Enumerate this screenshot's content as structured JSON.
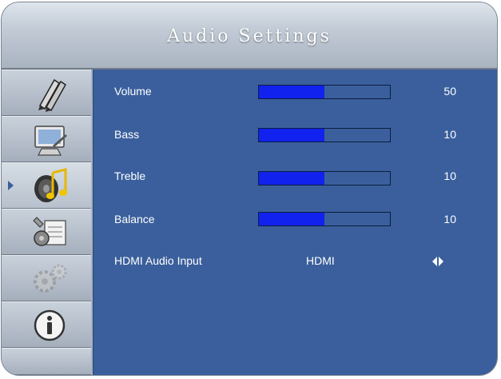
{
  "title": "Audio Settings",
  "sidebar": {
    "items": [
      {
        "icon": "pencils-icon"
      },
      {
        "icon": "monitor-icon"
      },
      {
        "icon": "music-note-icon",
        "active": true
      },
      {
        "icon": "tools-icon"
      },
      {
        "icon": "gears-icon"
      },
      {
        "icon": "info-icon"
      }
    ]
  },
  "settings": {
    "volume": {
      "label": "Volume",
      "value": "50",
      "level": 0.5
    },
    "bass": {
      "label": "Bass",
      "value": "10",
      "level": 0.5
    },
    "treble": {
      "label": "Treble",
      "value": "10",
      "level": 0.5
    },
    "balance": {
      "label": "Balance",
      "value": "10",
      "level": 0.5
    },
    "hdmi_audio_input": {
      "label": "HDMI Audio Input",
      "value": "HDMI"
    }
  },
  "colors": {
    "panel": "#3a5f9c",
    "bar_fill": "#1122ee",
    "text": "#ffffff"
  }
}
